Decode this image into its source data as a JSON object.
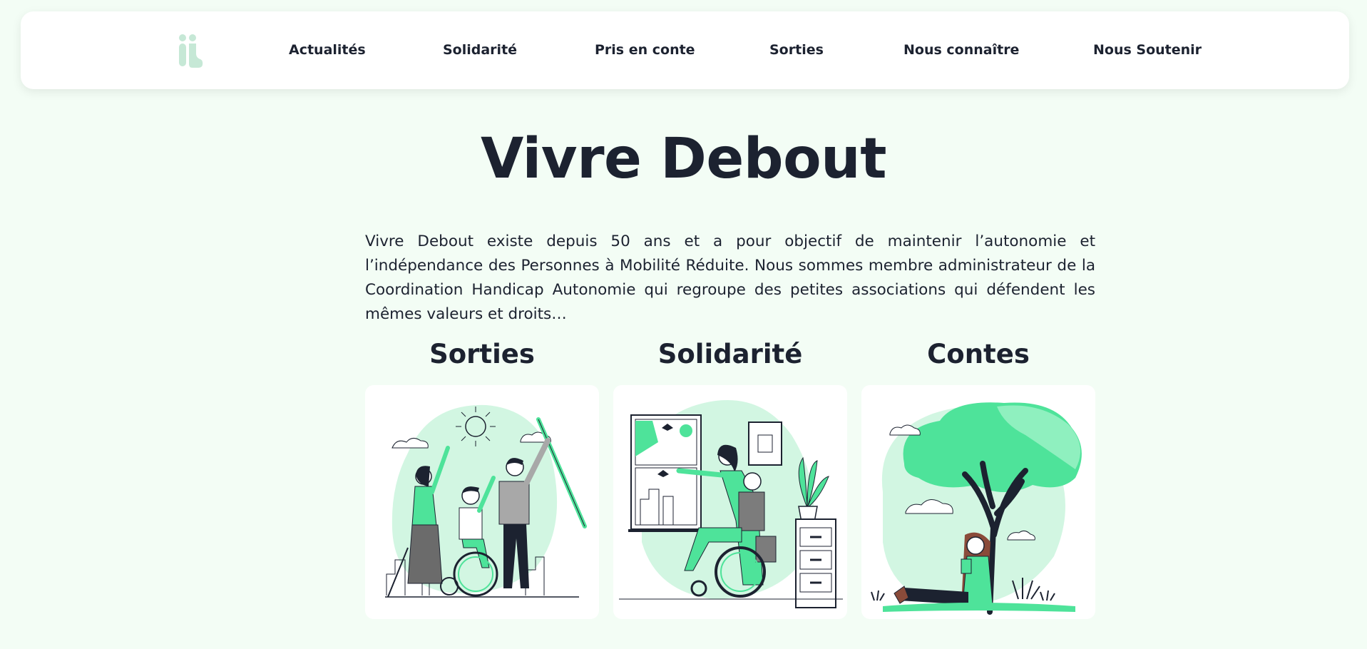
{
  "nav": {
    "logo": "logo-icon",
    "items": [
      {
        "label": "Actualités"
      },
      {
        "label": "Solidarité"
      },
      {
        "label": "Pris en conte"
      },
      {
        "label": "Sorties"
      },
      {
        "label": "Nous connaître"
      },
      {
        "label": "Nous Soutenir"
      }
    ]
  },
  "hero": {
    "title": "Vivre Debout",
    "intro": "Vivre Debout existe depuis 50 ans et a pour objectif de maintenir l’autonomie et l’indépendance des Personnes à Mobilité Réduite. Nous sommes membre administrateur de la Coordination Handicap Autonomie qui regroupe des petites associations qui défendent les mêmes valeurs et droits…"
  },
  "cards": [
    {
      "title": "Sorties",
      "illustration": "outing-illustration-icon"
    },
    {
      "title": "Solidarité",
      "illustration": "solidarity-illustration-icon"
    },
    {
      "title": "Contes",
      "illustration": "reading-illustration-icon"
    }
  ],
  "colors": {
    "background": "#f3fdf5",
    "accent_green": "#4ee39a",
    "light_green": "#d2f6e2",
    "text": "#1c2230",
    "logo": "#c6e8d6"
  }
}
